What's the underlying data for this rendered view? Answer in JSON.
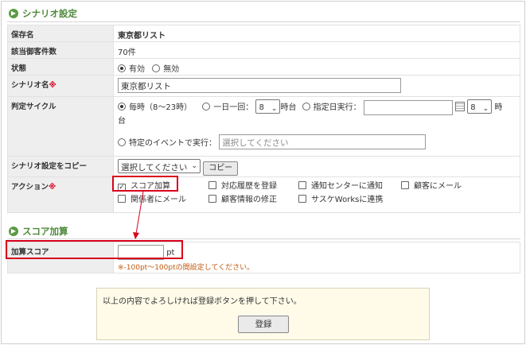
{
  "scenario_section": {
    "title": "シナリオ設定"
  },
  "fields": {
    "save_name": {
      "label": "保存名",
      "value": "東京都リスト"
    },
    "count": {
      "label": "該当御客件数",
      "value": "70件"
    },
    "status": {
      "label": "状態",
      "options": [
        "有効",
        "無効"
      ],
      "selected": "有効"
    },
    "scenario_name": {
      "label": "シナリオ名",
      "required_mark": "※",
      "value": "東京都リスト"
    },
    "cycle": {
      "label": "判定サイクル",
      "hourly_label": "毎時（8〜23時）",
      "daily_label": "一日一回：",
      "daily_hour": "8",
      "hour_suffix": "時台",
      "date_label": "指定日実行：",
      "date_value": "",
      "date_hour": "8",
      "date_hour_suffix_1": "時",
      "date_hour_suffix_2": "台",
      "event_label": "特定のイベントで実行：",
      "event_placeholder": "選択してください",
      "selected": "毎時（8〜23時）"
    },
    "copy": {
      "label": "シナリオ設定をコピー",
      "select_value": "選択してください",
      "button": "コピー"
    },
    "action": {
      "label": "アクション",
      "required_mark": "※",
      "items": [
        "スコア加算",
        "対応履歴を登録",
        "通知センターに通知",
        "顧客にメール",
        "関係者にメール",
        "顧客情報の修正",
        "サスケWorksに連携"
      ],
      "checked": [
        "スコア加算"
      ]
    }
  },
  "score_section": {
    "title": "スコア加算",
    "label": "加算スコア",
    "value": "",
    "unit": "pt",
    "note": "※-100pt〜100ptの間設定してください。"
  },
  "confirm": {
    "message": "以上の内容でよろしければ登録ボタンを押して下さい。",
    "button": "登録"
  },
  "colors": {
    "accent_green": "#4f8a3a",
    "required_red": "#d9001b",
    "note_orange": "#c2580e",
    "highlight_red": "#d9001b"
  }
}
